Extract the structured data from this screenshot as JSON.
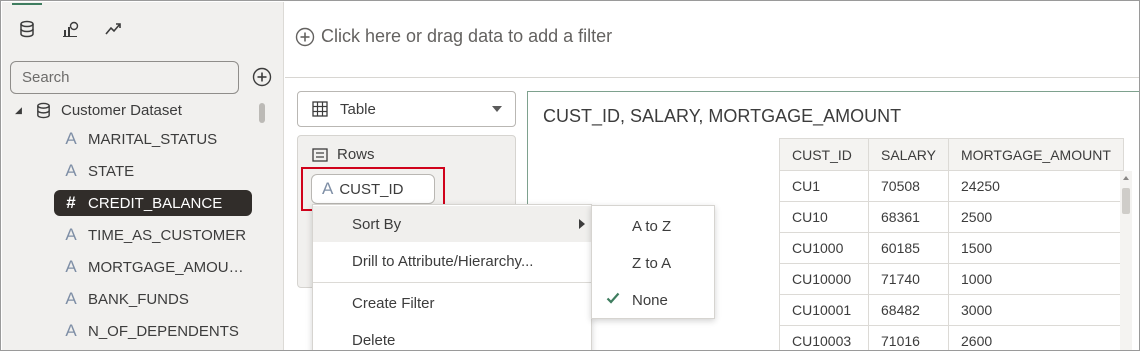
{
  "colors": {
    "accent": "#3f7d5f",
    "selected_bg": "#312d2a",
    "highlight_border": "#d0021b",
    "attribute_glyph": "#7f8fa6",
    "panel_bg": "#f1f0ee"
  },
  "left_panel": {
    "tabs": [
      {
        "icon": "database-icon",
        "active": true
      },
      {
        "icon": "visualizations-icon",
        "active": false
      },
      {
        "icon": "analytics-icon",
        "active": false
      }
    ],
    "search": {
      "placeholder": "Search",
      "value": ""
    },
    "add_icon": "add-circle-icon",
    "dataset": {
      "name": "Customer Dataset",
      "expanded": true
    },
    "columns": [
      {
        "glyph": "A",
        "label": "MARITAL_STATUS",
        "selected": false
      },
      {
        "glyph": "A",
        "label": "STATE",
        "selected": false
      },
      {
        "glyph": "#",
        "label": "CREDIT_BALANCE",
        "selected": true
      },
      {
        "glyph": "A",
        "label": "TIME_AS_CUSTOMER",
        "selected": false
      },
      {
        "glyph": "A",
        "label": "MORTGAGE_AMOU…",
        "selected": false
      },
      {
        "glyph": "A",
        "label": "BANK_FUNDS",
        "selected": false
      },
      {
        "glyph": "A",
        "label": "N_OF_DEPENDENTS",
        "selected": false
      }
    ]
  },
  "filter_bar": {
    "text": "Click here or drag data to add a filter"
  },
  "grammar": {
    "viz_type": "Table",
    "rows_label": "Rows",
    "row_chip": {
      "glyph": "A",
      "label": "CUST_ID"
    }
  },
  "canvas": {
    "title": "CUST_ID, SALARY, MORTGAGE_AMOUNT",
    "table": {
      "headers": [
        "CUST_ID",
        "SALARY",
        "MORTGAGE_AMOUNT"
      ],
      "rows": [
        [
          "CU1",
          "70508",
          "24250"
        ],
        [
          "CU10",
          "68361",
          "2500"
        ],
        [
          "CU1000",
          "60185",
          "1500"
        ],
        [
          "CU10000",
          "71740",
          "1000"
        ],
        [
          "CU10001",
          "68482",
          "3000"
        ],
        [
          "CU10003",
          "71016",
          "2600"
        ]
      ]
    }
  },
  "context_menu": {
    "items": [
      "Sort By",
      "Drill to Attribute/Hierarchy...",
      "Create Filter",
      "Delete"
    ],
    "sort_submenu": [
      "A to Z",
      "Z to A",
      "None"
    ],
    "sort_checked": "None"
  }
}
